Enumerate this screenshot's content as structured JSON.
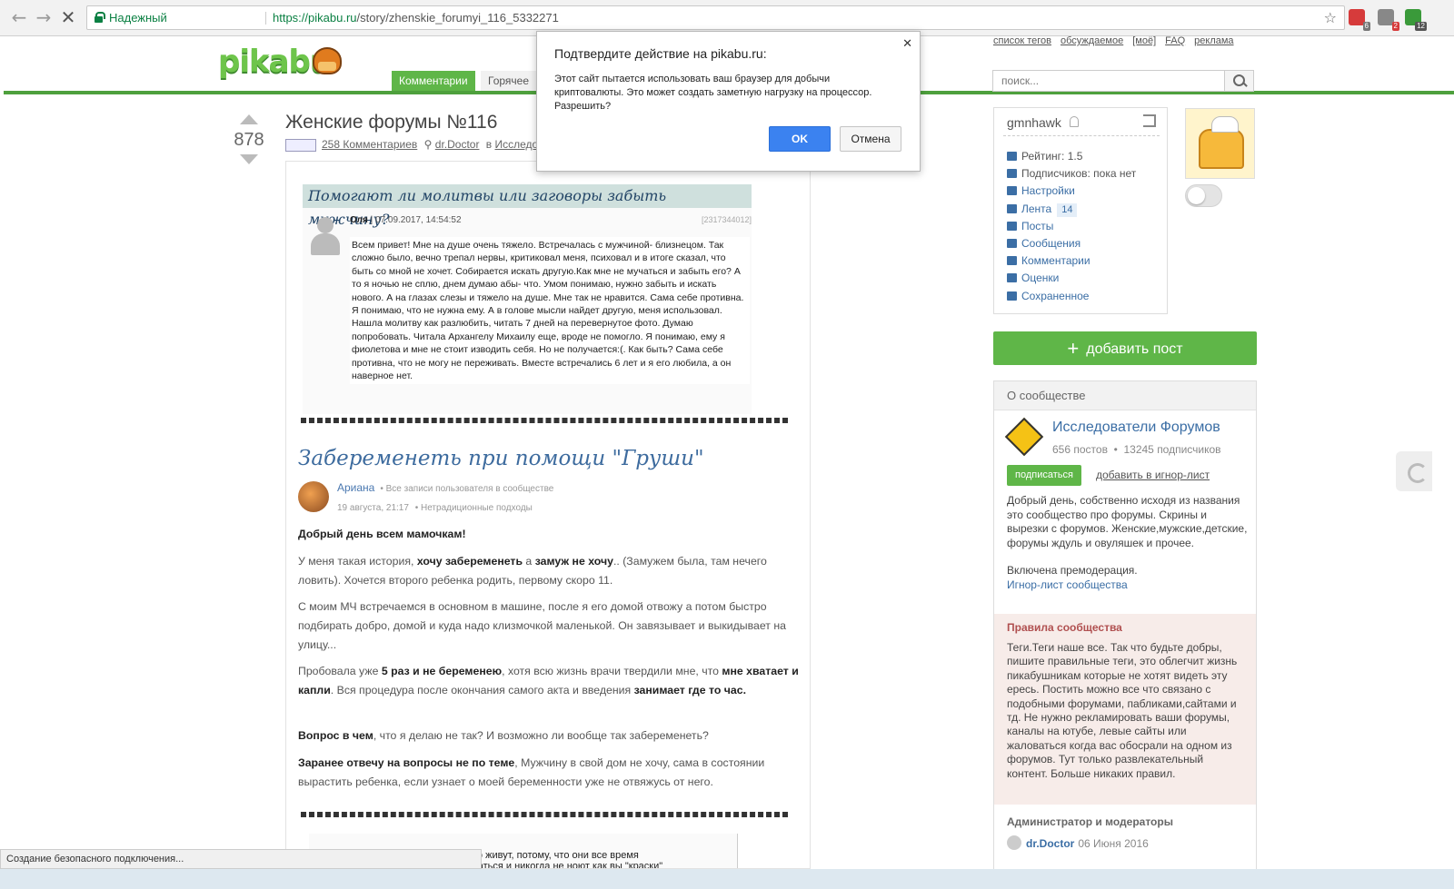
{
  "browser": {
    "secure_label": "Надежный",
    "url_host": "https://pikabu.ru",
    "url_path": "/story/zhenskie_forumyi_116_5332271",
    "ext_badges": [
      "6",
      "2",
      "12"
    ]
  },
  "header": {
    "logo": "pikabu",
    "tabs": [
      "Комментарии",
      "Горячее"
    ],
    "top_links": [
      "список тегов",
      "обсуждаемое",
      "[моё]",
      "FAQ",
      "реклама"
    ],
    "search_placeholder": "поиск..."
  },
  "story": {
    "rating": "878",
    "title": "Женские форумы №116",
    "comments": "258 Комментариев",
    "author": "dr.Doctor",
    "in_label": "в",
    "community": "Исследова"
  },
  "img1": {
    "heading": "Помогают ли молитвы или заговоры забыть мужчину?",
    "user": "Оля",
    "datetime": "| 07.09.2017, 14:54:52",
    "id": "[2317344012]",
    "text": "Всем привет! Мне на душе очень тяжело. Встречалась с мужчиной- близнецом. Так сложно было, вечно трепал нервы, критиковал меня, психовал и в итоге сказал, что быть со мной не хочет. Собирается искать другую.Как мне не мучаться и забыть его? А то я ночью не сплю, днем думаю абы- что. Умом понимаю, нужно забыть и искать нового. А на глазах слезы и тяжело на душе. Мне так не нравится. Сама себе противна. Я понимаю, что не нужна ему. А в голове мысли найдет другую, меня использовал. Нашла молитву как разлюбить, читать 7 дней на перевернутое фото. Думаю попробовать. Читала Архангелу Михаилу еще, вроде не помогло. Я понимаю, ему я фиолетова и мне не стоит изводить себя. Но не получается:(. Как быть? Сама себе противна, что не могу не переживать. Вместе встречались 6 лет и я его любила, а он наверное нет."
  },
  "img2": {
    "title": "Забеременеть при помощи \"Груши\"",
    "author": "Ариана",
    "all_posts": "• Все записи пользователя в сообществе",
    "date": "19 августа, 21:17",
    "category": "• Нетрадиционные подходы",
    "p1": "Добрый день всем мамочкам!",
    "p2_a": "У меня такая история, ",
    "p2_b": "хочу забеременеть",
    "p2_c": " а ",
    "p2_d": "замуж не хочу",
    "p2_e": ".. (Замужем была, там нечего ловить). Хочется второго ребенка родить, первому скоро 11.",
    "p3": "С моим МЧ встречаемся в основном в машине, после я его домой отвожу а потом быстро подбирать добро, домой и куда надо клизмочкой маленькой. Он завязывает и выкидывает на улицу...",
    "p4_a": "Пробовала уже ",
    "p4_b": "5 раз и не беременею",
    "p4_c": ", хотя всю жизнь врачи твердили мне, что ",
    "p4_d": "мне хватает и капли",
    "p4_e": ". Вся процедура после окончания самого акта и введения ",
    "p4_f": "занимает где то час.",
    "p5_a": "Вопрос в чем",
    "p5_b": ", что я делаю не так? И возможно ли вообще так забеременеть?",
    "p6_a": "Заранее отвечу на вопросы не по теме",
    "p6_b": ", Мужчину в свой дом не хочу, сама в состоянии вырастить ребенка, если узнает о моей беременности уже не отвяжусь от него."
  },
  "img3": {
    "line1": "то живут, потому, что они все время",
    "line2": "ваться и никогда не ноют как вы \"краски\""
  },
  "dialog": {
    "title": "Подтвердите действие на pikabu.ru:",
    "message": "Этот сайт пытается использовать ваш браузер для добычи криптовалюты. Это может создать заметную нагрузку на процессор. Разрешить?",
    "ok": "OK",
    "cancel": "Отмена"
  },
  "user": {
    "name": "gmnhawk",
    "menu": [
      {
        "label": "Рейтинг: 1.5",
        "icon": "rating-icon"
      },
      {
        "label": "Подписчиков: пока нет",
        "icon": "subscribers-icon"
      },
      {
        "label": "Настройки",
        "icon": "gear-icon"
      },
      {
        "label": "Лента",
        "icon": "feed-icon",
        "count": "14"
      },
      {
        "label": "Посты",
        "icon": "posts-icon"
      },
      {
        "label": "Сообщения",
        "icon": "envelope-icon"
      },
      {
        "label": "Комментарии",
        "icon": "comment-icon"
      },
      {
        "label": "Оценки",
        "icon": "triangle-icon"
      },
      {
        "label": "Сохраненное",
        "icon": "save-icon"
      }
    ]
  },
  "add_post": "добавить пост",
  "community": {
    "header": "О сообществе",
    "name": "Исследователи Форумов",
    "posts": "656 постов",
    "subscribers": "13245 подписчиков",
    "subscribe": "подписаться",
    "ignore": "добавить в игнор-лист",
    "desc": "Добрый день, собственно исходя из названия это сообщество про форумы. Скрины и вырезки с форумов. Женские,мужские,детские, форумы ждуль и овуляшек и прочее.",
    "premod": "Включена премодерация.",
    "ignore_link": "Игнор-лист сообщества",
    "rules_title": "Правила сообщества",
    "rules": "Теги.Теги наше все. Так что будьте добры, пишите правильные теги, это облегчит жизнь пикабушникам которые не хотят видеть эту ересь. Постить можно все что связано с подобными форумами, пабликами,сайтами и тд. Не нужно рекламировать ваши форумы, каналы на ютубе, левые сайты или жаловаться когда вас обосрали на одном из форумов. Тут только развлекательный контент. Больше никаких правил.",
    "admins_title": "Администратор и модераторы",
    "mod_name": "dr.Doctor",
    "mod_date": "06 Июня 2016"
  },
  "status": "Создание безопасного подключения..."
}
